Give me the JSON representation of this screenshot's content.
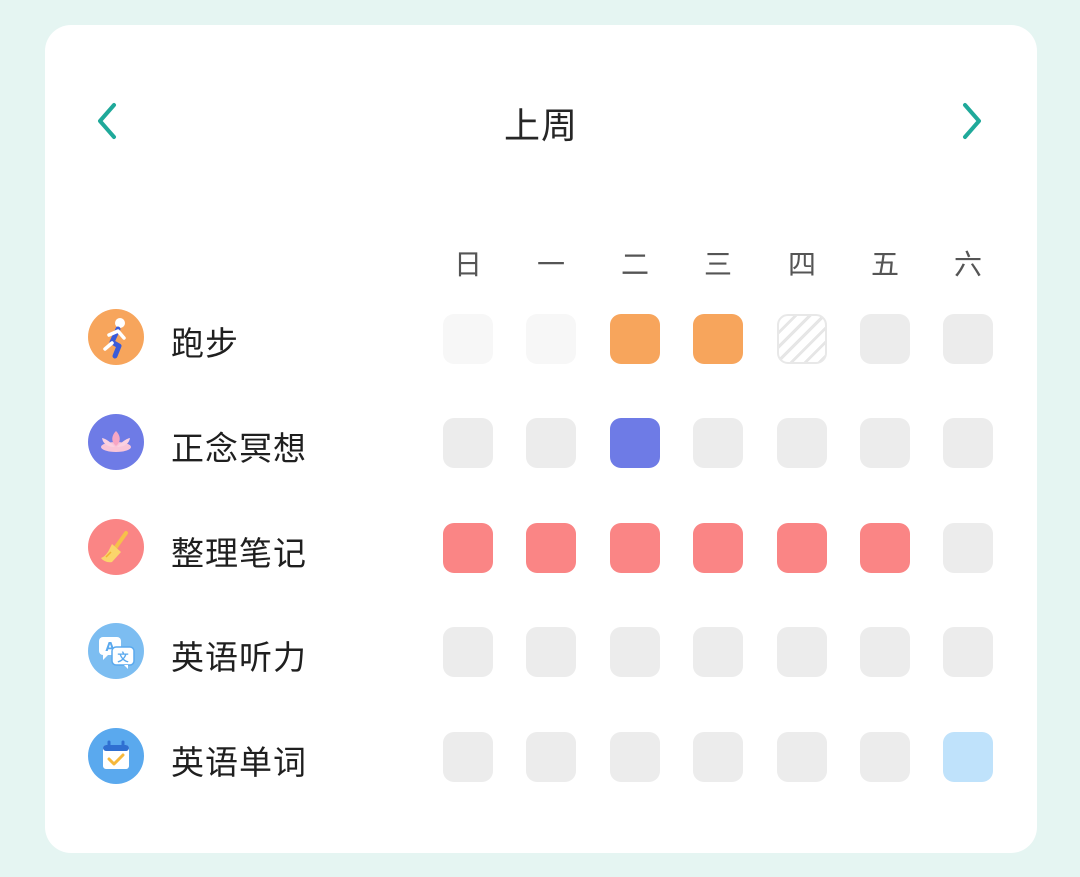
{
  "header": {
    "title": "上周",
    "prev_icon": "chevron-left-icon",
    "next_icon": "chevron-right-icon",
    "accent_color": "#1fa99a"
  },
  "days": [
    "日",
    "一",
    "二",
    "三",
    "四",
    "五",
    "六"
  ],
  "habits": [
    {
      "name": "跑步",
      "icon": "running-icon",
      "color": "#f7a55c",
      "states": [
        "faint",
        "faint",
        "done",
        "done",
        "skipped",
        "empty",
        "empty"
      ]
    },
    {
      "name": "正念冥想",
      "icon": "lotus-icon",
      "color": "#6e7be6",
      "states": [
        "empty",
        "empty",
        "done",
        "empty",
        "empty",
        "empty",
        "empty"
      ]
    },
    {
      "name": "整理笔记",
      "icon": "broom-icon",
      "color": "#fa8585",
      "states": [
        "done",
        "done",
        "done",
        "done",
        "done",
        "done",
        "empty"
      ]
    },
    {
      "name": "英语听力",
      "icon": "translate-icon",
      "color": "#7cbdf1",
      "states": [
        "empty",
        "empty",
        "empty",
        "empty",
        "empty",
        "empty",
        "empty"
      ]
    },
    {
      "name": "英语单词",
      "icon": "calendar-check-icon",
      "color": "#5aa9ee",
      "states": [
        "empty",
        "empty",
        "empty",
        "empty",
        "empty",
        "empty",
        "done-light"
      ],
      "light_color": "#bfe2fb"
    }
  ]
}
